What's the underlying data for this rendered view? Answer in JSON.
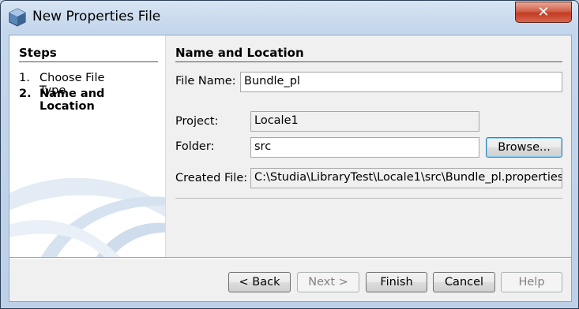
{
  "window": {
    "title": "New Properties File",
    "close_glyph": "✕"
  },
  "steps": {
    "heading": "Steps",
    "items": [
      {
        "number": "1.",
        "label": "Choose File Type",
        "current": false
      },
      {
        "number": "2.",
        "label": "Name and Location",
        "current": true
      }
    ]
  },
  "panel": {
    "heading": "Name and Location",
    "file_name": {
      "label": "File Name:",
      "value": "Bundle_pl"
    },
    "project": {
      "label": "Project:",
      "value": "Locale1"
    },
    "folder": {
      "label": "Folder:",
      "value": "src",
      "browse_label": "Browse..."
    },
    "created_file": {
      "label": "Created File:",
      "value": "C:\\Studia\\LibraryTest\\Locale1\\src\\Bundle_pl.properties"
    }
  },
  "buttons": {
    "back": "< Back",
    "next": "Next >",
    "finish": "Finish",
    "cancel": "Cancel",
    "help": "Help"
  },
  "colors": {
    "title_bar": "#c3d6ec",
    "close_button": "#c23b22",
    "dialog_bg": "#f0f0f0"
  }
}
